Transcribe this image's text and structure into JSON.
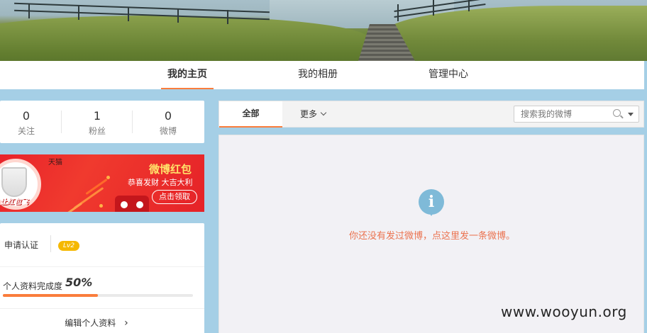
{
  "nav": {
    "tabs": [
      {
        "label": "我的主页",
        "active": true
      },
      {
        "label": "我的相册",
        "active": false
      },
      {
        "label": "管理中心",
        "active": false
      }
    ]
  },
  "stats": [
    {
      "count": "0",
      "label": "关注"
    },
    {
      "count": "1",
      "label": "粉丝"
    },
    {
      "count": "0",
      "label": "微博"
    }
  ],
  "promo": {
    "brand": "天猫",
    "slogan": "让红包飞",
    "title": "微博红包",
    "subtitle": "恭喜发财 大吉大利",
    "button": "点击领取"
  },
  "profile": {
    "verify_label": "申请认证",
    "level_badge": "Lv2",
    "completion_label": "个人资料完成度",
    "completion_percent": "50%",
    "completion_value": 0.5,
    "edit_label": "编辑个人资料",
    "edit_chevron": "›"
  },
  "feed": {
    "tab_all": "全部",
    "tab_more": "更多",
    "search_placeholder": "搜索我的微博",
    "info_glyph": "i",
    "empty_message": "你还没有发过微博，点这里发一条微博。"
  },
  "watermark": "www.wooyun.org",
  "colors": {
    "accent": "#fa7d3c",
    "background": "#a5cfe6",
    "empty_message": "#eb7350",
    "info_icon": "#7fbad8",
    "level_badge": "#f5b800"
  }
}
